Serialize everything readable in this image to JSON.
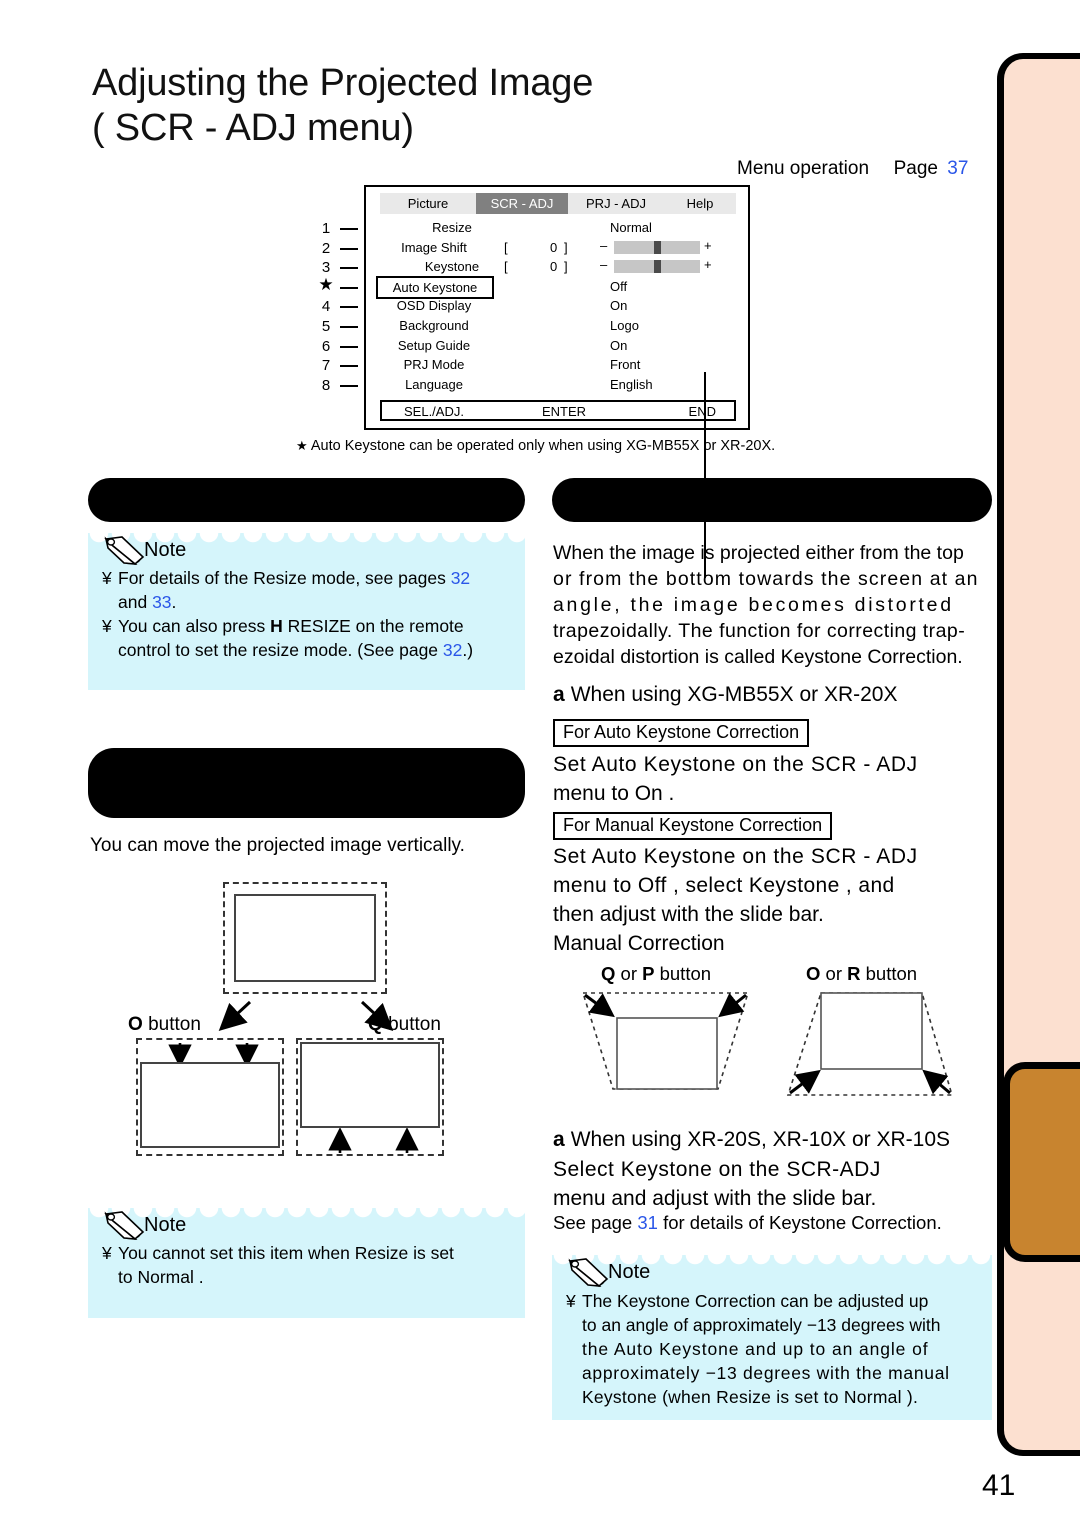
{
  "page": {
    "number": "41",
    "title_line1": "Adjusting the Projected Image",
    "title_line2": "( SCR - ADJ  menu)"
  },
  "menu_operation": {
    "label": "Menu operation",
    "page_label": "Page",
    "page_number": "37"
  },
  "osd": {
    "tabs": [
      "Picture",
      "SCR - ADJ",
      "PRJ - ADJ",
      "Help"
    ],
    "active_tab": "SCR - ADJ",
    "rows": [
      {
        "num": "1",
        "label": "Resize",
        "value": "Normal",
        "type": "value"
      },
      {
        "num": "2",
        "label": "Image Shift",
        "bracket_open": "[",
        "bracket_value": "0",
        "bracket_close": "]",
        "minus": "–",
        "plus": "+",
        "type": "slider"
      },
      {
        "num": "3",
        "label": "Keystone",
        "bracket_open": "[",
        "bracket_value": "0",
        "bracket_close": "]",
        "minus": "–",
        "plus": "+",
        "type": "slider"
      },
      {
        "num": "★",
        "label": "Auto Keystone",
        "value": "Off",
        "type": "boxed"
      },
      {
        "num": "4",
        "label": "OSD Display",
        "value": "On",
        "type": "value"
      },
      {
        "num": "5",
        "label": "Background",
        "value": "Logo",
        "type": "value"
      },
      {
        "num": "6",
        "label": "Setup Guide",
        "value": "On",
        "type": "value"
      },
      {
        "num": "7",
        "label": "PRJ Mode",
        "value": "Front",
        "type": "value"
      },
      {
        "num": "8",
        "label": "Language",
        "value": "English",
        "type": "value"
      }
    ],
    "footer": [
      "SEL./ADJ.",
      "ENTER",
      "END"
    ],
    "footnote_star": "★",
    "footnote": "Auto Keystone  can be operated only when using XG-MB55X or XR-20X."
  },
  "left_column": {
    "note1": {
      "heading": "Note",
      "items": [
        {
          "bullet": "¥",
          "line1_a": "For details of the Resize mode, see pages ",
          "line1_page": "32",
          "line2_a": "and ",
          "line2_page": "33",
          "line2_b": "."
        },
        {
          "bullet": "¥",
          "pre": "You can also press ",
          "key": "H",
          "post": " RESIZE on the remote",
          "line2_a": "control to set the resize mode. (See page ",
          "line2_page": "32",
          "line2_b": ".)"
        }
      ]
    },
    "body_text": "You can move the projected image vertically.",
    "diagram": {
      "left_button_label": "button",
      "left_button_key": "O",
      "right_button_label": "button",
      "right_button_key": "Q"
    },
    "note2": {
      "heading": "Note",
      "items": [
        {
          "bullet": "¥",
          "line1": "You cannot set this item when  Resize  is set",
          "line2": "to  Normal ."
        }
      ]
    }
  },
  "right_column": {
    "paragraph_lines": [
      "When the image is projected either from the top",
      "or from the bottom towards the screen at an",
      "angle, the image becomes distorted",
      "trapezoidally. The function for correcting trap-",
      "ezoidal distortion is called Keystone Correction."
    ],
    "heading1_marker": "a",
    "heading1": "When using XG-MB55X or XR-20X",
    "boxed1": "For Auto Keystone Correction",
    "instr1_line1": "Set  Auto Keystone    on the  SCR - ADJ",
    "instr1_line2": "menu to  On .",
    "boxed2": "For Manual Keystone Correction",
    "instr2_line1": "Set  Auto Keystone    on the  SCR - ADJ",
    "instr2_line2": "menu to  Off , select  Keystone , and",
    "instr2_line3": "then adjust with the slide bar.",
    "manual_correction": "Manual Correction",
    "trap_left_key1": "Q",
    "trap_left_or": "or",
    "trap_left_key2": "P",
    "trap_left_label": "button",
    "trap_right_key1": "O",
    "trap_right_or": "or",
    "trap_right_key2": "R",
    "trap_right_label": "button",
    "heading2_marker": "a",
    "heading2": "When using XR-20S, XR-10X or XR-10S",
    "instr3_line1": "Select   Keystone    on the   SCR-ADJ",
    "instr3_line2": "menu and adjust with the slide bar.",
    "see_page_pre": "See page ",
    "see_page_num": "31",
    "see_page_post": " for details of Keystone Correction.",
    "note3": {
      "heading": "Note",
      "items": [
        {
          "bullet": "¥",
          "line1": "The Keystone Correction can be adjusted up",
          "line2": "to an angle of approximately −13 degrees with",
          "line3": "the  Auto Keystone  and up to an angle of",
          "line4": "approximately −13 degrees with the manual",
          "line5": "Keystone  (when  Resize  is set to  Normal )."
        }
      ]
    }
  },
  "colors": {
    "note_background": "#d5f5fb",
    "page_link": "#2a56e8",
    "rail": "#fce0d0",
    "rail_tab": "#c8842f",
    "osd_active_tab": "#808080"
  }
}
